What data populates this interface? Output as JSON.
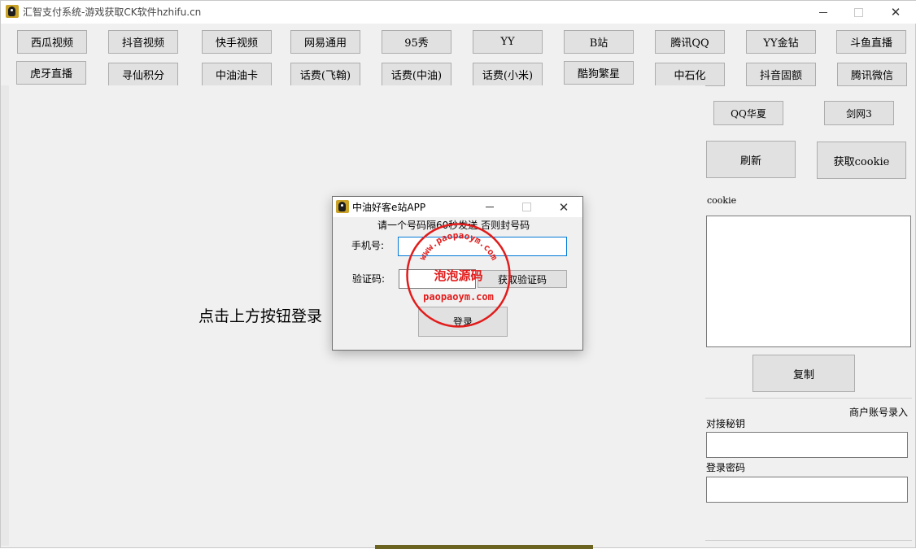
{
  "window": {
    "title": "汇智支付系统-游戏获取CK软件hzhifu.cn",
    "controls": {
      "minimize": "minimize-icon",
      "maximize": "maximize-icon",
      "close": "close-icon",
      "close_glyph": "✕"
    }
  },
  "platforms": {
    "row1": [
      "西瓜视频",
      "抖音视频",
      "快手视频",
      "网易通用",
      "95秀",
      "YY",
      "B站",
      "腾讯QQ",
      "YY金钻",
      "斗鱼直播"
    ],
    "row2": [
      "虎牙直播",
      "寻仙积分",
      "中油油卡",
      "话费(飞翰)",
      "话费(中油)",
      "话费(小米)",
      "酷狗繁星",
      "中石化",
      "抖音固额",
      "腾讯微信"
    ]
  },
  "main": {
    "hint": "点击上方按钮登录"
  },
  "side": {
    "qq_huaxia": "QQ华夏",
    "jianwang3": "剑网3",
    "refresh": "刷新",
    "get_cookie": "获取cookie",
    "cookie_label": "cookie",
    "cookie_value": "",
    "copy": "复制",
    "merchant_group": "商户账号录入",
    "secret_label": "对接秘钥",
    "secret_value": "",
    "password_label": "登录密码",
    "password_value": ""
  },
  "dialog": {
    "title": "中油好客e站APP",
    "notice": "请一个号码隔60秒发送 否则封号码",
    "phone_label": "手机号:",
    "phone_value": "",
    "code_label": "验证码:",
    "code_value": "",
    "get_code": "获取验证码",
    "login": "登录",
    "close_glyph": "✕"
  },
  "watermark": {
    "top_text": "www.paopaoym.com",
    "center_text": "泡泡源码",
    "bottom_text": "paopaoym.com",
    "color": "#e21b1b"
  },
  "colors": {
    "window_bg": "#f0f0f0",
    "button_bg": "#e1e1e1",
    "button_border": "#adadad",
    "focus_border": "#0078d7"
  }
}
